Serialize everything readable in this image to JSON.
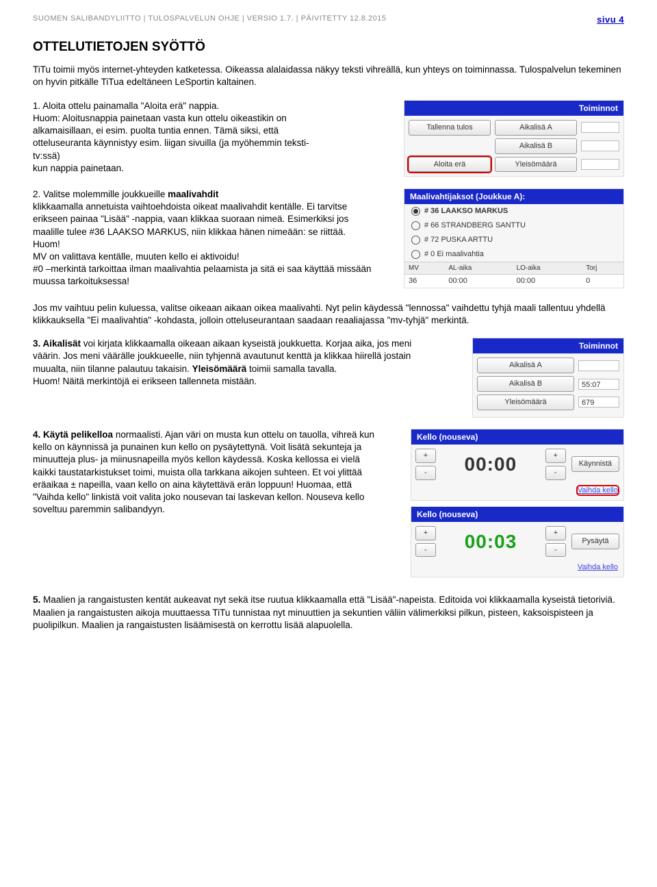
{
  "header": {
    "breadcrumb": "SUOMEN SALIBANDYLIITTO | TULOSPALVELUN OHJE | VERSIO 1.7. | PÄIVITETTY 12.8.2015",
    "page": "sivu 4"
  },
  "title": "OTTELUTIETOJEN SYÖTTÖ",
  "intro": "TiTu toimii myös internet-yhteyden katketessa. Oikeassa alalaidassa näkyy teksti vihreällä, kun yhteys on toiminnassa. Tulospalvelun tekeminen on hyvin pitkälle TiTua edeltäneen LeSportin kaltainen.",
  "s1": {
    "lead": "1. Aloita ottelu painamalla \"Aloita erä\" nappia.",
    "body1": "Huom: Aloitusnappia painetaan vasta kun ottelu oikeastikin on alkamaisillaan, ei esim. puolta tuntia ennen. Tämä siksi, että otteluseuranta käynnistyy esim. liigan sivuilla (ja myöhemmin teksti-tv:ssä)",
    "body2": "kun nappia painetaan."
  },
  "mock1": {
    "toiminnot": "Toiminnot",
    "tallenna": "Tallenna tulos",
    "aloita": "Aloita erä",
    "aA": "Aikalisä A",
    "aB": "Aikalisä B",
    "ym": "Yleisömäärä"
  },
  "s2": {
    "lead": "2. Valitse molemmille joukkueille ",
    "leadbold": "maalivahdit",
    "body": "klikkaamalla annetuista vaihtoehdoista oikeat maalivahdit kentälle. Ei tarvitse erikseen painaa \"Lisää\" -nappia, vaan klikkaa suoraan nimeä. Esimerkiksi jos maalille tulee #36 LAAKSO MARKUS, niin klikkaa hänen nimeään: se riittää. Huom!",
    "body2": "MV on valittava kentälle, muuten kello ei aktivoidu!",
    "body3": "#0 –merkintä tarkoittaa ilman maalivahtia pelaamista ja sitä ei saa käyttää missään muussa tarkoituksessa!"
  },
  "mock2": {
    "title": "Maalivahtijaksot (Joukkue A):",
    "o1": "# 36 LAAKSO MARKUS",
    "o2": "# 66 STRANDBERG SANTTU",
    "o3": "# 72 PUSKA ARTTU",
    "o4": "# 0 Ei maalivahtia",
    "h_mv": "MV",
    "h_al": "AL-aika",
    "h_lo": "LO-aika",
    "h_torj": "Torj",
    "r_mv": "36",
    "r_al": "00:00",
    "r_lo": "00:00",
    "r_torj": "0"
  },
  "para_after2": "Jos mv vaihtuu pelin kuluessa, valitse oikeaan aikaan oikea maalivahti. Nyt pelin käydessä \"lennossa\" vaihdettu tyhjä maali tallentuu yhdellä klikkauksella \"Ei maalivahtia\" -kohdasta, jolloin otteluseurantaan saadaan reaaliajassa \"mv-tyhjä\" merkintä.",
  "s3": {
    "leadbold": "3. Aikalisät",
    "body": " voi kirjata klikkaamalla oikeaan aikaan kyseistä joukkuetta. Korjaa aika, jos meni väärin. Jos meni väärälle joukkueelle, niin tyhjennä avautunut kenttä ja klikkaa hiirellä jostain muualta, niin tilanne palautuu takaisin. ",
    "yleiso": "Yleisömäärä",
    "body2": " toimii samalla tavalla.",
    "body3": "Huom! Näitä merkintöjä ei erikseen tallenneta mistään."
  },
  "mock3": {
    "toiminnot": "Toiminnot",
    "aA": "Aikalisä A",
    "vA": "",
    "aB": "Aikalisä B",
    "vB": "55:07",
    "ym": "Yleisömäärä",
    "vY": "679"
  },
  "s4": {
    "lead": "4. Käytä ",
    "leadbold": "pelikelloa",
    "body": " normaalisti. Ajan väri on musta kun ottelu on tauolla, vihreä kun kello on käynnissä ja punainen kun kello on pysäytettynä. Voit lisätä sekunteja ja minuutteja plus- ja miinusnapeilla myös kellon käydessä. Koska kellossa ei vielä kaikki taustatarkistukset toimi, muista olla tarkkana aikojen suhteen. Et voi ylittää eräaikaa ± napeilla, vaan kello on aina käytettävä erän loppuun! Huomaa, että \"Vaihda kello\" linkistä voit valita joko nousevan tai laskevan kellon. Nouseva kello soveltuu paremmin salibandyyn."
  },
  "mock4a": {
    "title": "Kello (nouseva)",
    "plus": "+",
    "minus": "-",
    "time": "00:00",
    "action": "Käynnistä",
    "link": "Vaihda kello"
  },
  "mock4b": {
    "title": "Kello (nouseva)",
    "plus": "+",
    "minus": "-",
    "time": "00:03",
    "action": "Pysäytä",
    "link": "Vaihda kello"
  },
  "s5": {
    "lead": "5.",
    "body": " Maalien ja rangaistusten kentät aukeavat nyt sekä itse ruutua klikkaamalla että \"Lisää\"-napeista. Editoida voi klikkaamalla kyseistä tietoriviä. Maalien ja rangaistusten aikoja muuttaessa TiTu tunnistaa nyt minuuttien ja sekuntien väliin välimerkiksi pilkun, pisteen, kaksoispisteen ja puolipilkun. Maalien ja rangaistusten lisäämisestä on kerrottu lisää alapuolella."
  }
}
